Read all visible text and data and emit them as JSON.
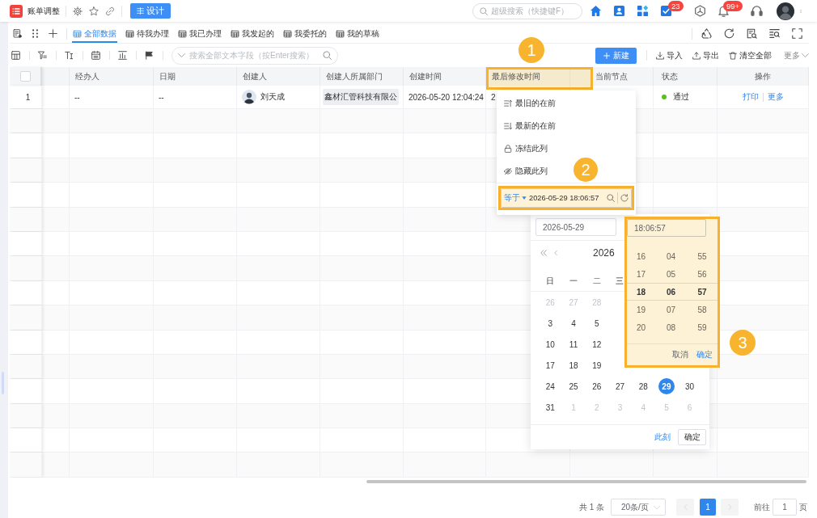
{
  "topbar": {
    "app_title": "账单调整",
    "design_button": "设计",
    "search": {
      "placeholder": "超级搜索（快捷键F）"
    },
    "task_badge": "23",
    "notification_badge": "99+"
  },
  "view_tabs": [
    {
      "label": "全部数据",
      "selected": true
    },
    {
      "label": "待我办理",
      "selected": false
    },
    {
      "label": "我已办理",
      "selected": false
    },
    {
      "label": "我发起的",
      "selected": false
    },
    {
      "label": "我委托的",
      "selected": false
    },
    {
      "label": "我的草稿",
      "selected": false
    }
  ],
  "toolbar": {
    "search": {
      "placeholder": "搜索全部文本字段（按Enter搜索）"
    },
    "new_button": "新建",
    "import_button": "导入",
    "export_button": "导出",
    "clear_button": "清空全部",
    "more_button": "更多"
  },
  "table": {
    "select_all": {
      "checked": false
    },
    "columns": [
      "经办人",
      "日期",
      "创建人",
      "创建人所属部门",
      "创建时间",
      "最后修改时间",
      "当前节点",
      "状态",
      "操作"
    ],
    "rows": [
      {
        "index": "1",
        "cells": [
          {
            "kind": "text",
            "text": "--"
          },
          {
            "kind": "text",
            "text": "--"
          },
          {
            "kind": "user",
            "text": "刘天成"
          },
          {
            "kind": "tag",
            "text": "鑫材汇管科技有限公"
          },
          {
            "kind": "text",
            "text": "2026-05-20 12:04:24"
          },
          {
            "kind": "text",
            "text": "2"
          },
          {
            "kind": "blank"
          },
          {
            "kind": "status",
            "text": "通过",
            "color": "#52c41a"
          },
          {
            "kind": "links",
            "links": [
              "打印",
              "更多"
            ]
          }
        ]
      }
    ]
  },
  "column_menu": {
    "items": [
      {
        "kind": "ascending",
        "label": "最旧的在前"
      },
      {
        "kind": "descending",
        "label": "最新的在前"
      },
      {
        "kind": "freeze",
        "label": "冻结此列"
      },
      {
        "kind": "hide",
        "label": "隐藏此列"
      }
    ],
    "filter": {
      "operator": "等于",
      "value": "2026-05-29 18:06:57"
    }
  },
  "date_picker": {
    "date_value": "2026-05-29",
    "title": "2026",
    "weekdays": [
      "日",
      "一",
      "二",
      "三"
    ],
    "weeks": [
      [
        {
          "day": "26",
          "muted": true,
          "selected": false
        },
        {
          "day": "27",
          "muted": true,
          "selected": false
        },
        {
          "day": "28",
          "muted": true,
          "selected": false
        }
      ],
      [
        {
          "day": "3",
          "muted": false,
          "selected": false
        },
        {
          "day": "4",
          "muted": false,
          "selected": false
        },
        {
          "day": "5",
          "muted": false,
          "selected": false
        }
      ],
      [
        {
          "day": "10",
          "muted": false,
          "selected": false
        },
        {
          "day": "11",
          "muted": false,
          "selected": false
        },
        {
          "day": "12",
          "muted": false,
          "selected": false
        }
      ],
      [
        {
          "day": "17",
          "muted": false,
          "selected": false
        },
        {
          "day": "18",
          "muted": false,
          "selected": false
        },
        {
          "day": "19",
          "muted": false,
          "selected": false
        }
      ],
      [
        {
          "day": "24",
          "muted": false,
          "selected": false
        },
        {
          "day": "25",
          "muted": false,
          "selected": false
        },
        {
          "day": "26",
          "muted": false,
          "selected": false
        },
        {
          "day": "27",
          "muted": false,
          "selected": false
        },
        {
          "day": "28",
          "muted": false,
          "selected": false
        },
        {
          "day": "29",
          "muted": false,
          "selected": true
        },
        {
          "day": "30",
          "muted": false,
          "selected": false
        }
      ],
      [
        {
          "day": "31",
          "muted": false,
          "selected": false
        },
        {
          "day": "1",
          "muted": true,
          "selected": false
        },
        {
          "day": "2",
          "muted": true,
          "selected": false
        },
        {
          "day": "3",
          "muted": true,
          "selected": false
        },
        {
          "day": "4",
          "muted": true,
          "selected": false
        },
        {
          "day": "5",
          "muted": true,
          "selected": false
        },
        {
          "day": "6",
          "muted": true,
          "selected": false
        }
      ]
    ],
    "now_link": "此刻",
    "confirm_button": "确定"
  },
  "time_picker": {
    "value": "18:06:57",
    "hours": [
      {
        "label": "16",
        "selected": false
      },
      {
        "label": "17",
        "selected": false
      },
      {
        "label": "18",
        "selected": true
      },
      {
        "label": "19",
        "selected": false
      },
      {
        "label": "20",
        "selected": false
      }
    ],
    "minutes": [
      {
        "label": "04",
        "selected": false
      },
      {
        "label": "05",
        "selected": false
      },
      {
        "label": "06",
        "selected": true
      },
      {
        "label": "07",
        "selected": false
      },
      {
        "label": "08",
        "selected": false
      }
    ],
    "seconds": [
      {
        "label": "55",
        "selected": false
      },
      {
        "label": "56",
        "selected": false
      },
      {
        "label": "57",
        "selected": true
      },
      {
        "label": "58",
        "selected": false
      },
      {
        "label": "59",
        "selected": false
      }
    ],
    "cancel_button": "取消",
    "confirm_button": "确定"
  },
  "pagination": {
    "total": "共 1 条",
    "page_size": "20条/页",
    "prev_disabled": true,
    "pages": [
      {
        "label": "1",
        "selected": true
      }
    ],
    "next_disabled": true,
    "goto_label": "前往",
    "goto_value": "1",
    "goto_suffix": "页"
  },
  "annotations": [
    {
      "label": "1"
    },
    {
      "label": "2"
    },
    {
      "label": "3"
    }
  ]
}
